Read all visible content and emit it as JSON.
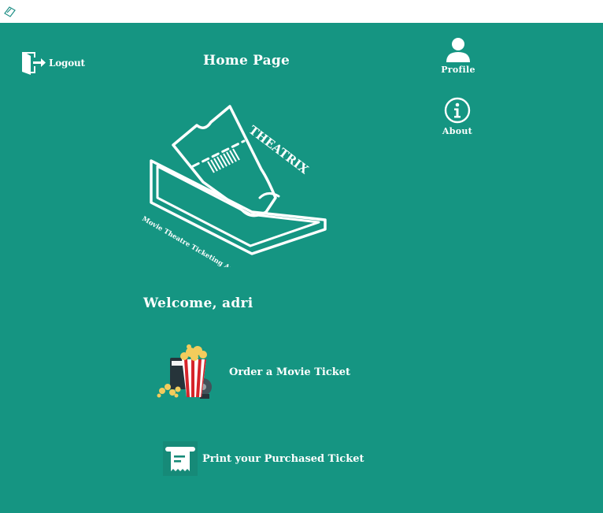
{
  "window": {
    "icon": "theatrix-app-icon"
  },
  "header": {
    "logout_label": "Logout",
    "logout_icon": "door-exit-icon",
    "title": "Home Page"
  },
  "nav": {
    "profile_label": "Profile",
    "profile_icon": "user-icon",
    "about_label": "About",
    "about_icon": "info-icon"
  },
  "logo": {
    "brand": "THEATRIX",
    "tagline": "Movie Theatre Ticketing App",
    "icon": "ticket-logo-icon"
  },
  "welcome": "Welcome, adri",
  "actions": {
    "order_label": "Order a Movie Ticket",
    "order_icon": "popcorn-icon",
    "print_label": "Print your Purchased Ticket",
    "print_icon": "receipt-icon"
  },
  "colors": {
    "background": "#159582",
    "foreground": "#ffffff",
    "titlebar": "#ffffff"
  }
}
